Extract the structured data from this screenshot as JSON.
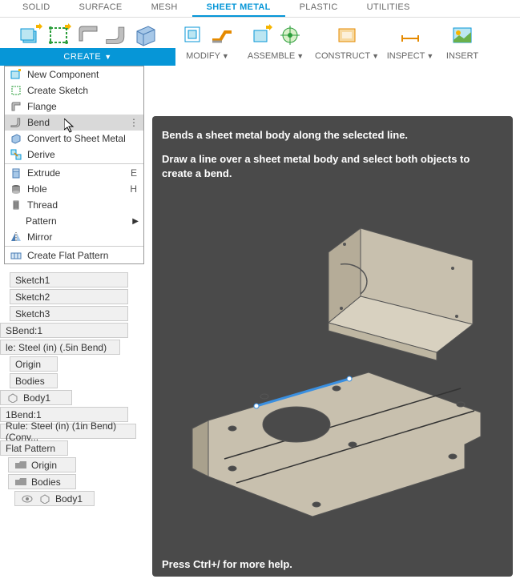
{
  "tabs": {
    "solid": "SOLID",
    "surface": "SURFACE",
    "mesh": "MESH",
    "sheetmetal": "SHEET METAL",
    "plastic": "PLASTIC",
    "utilities": "UTILITIES"
  },
  "toolbar_groups": {
    "create": "CREATE",
    "modify": "MODIFY",
    "assemble": "ASSEMBLE",
    "construct": "CONSTRUCT",
    "inspect": "INSPECT",
    "insert": "INSERT"
  },
  "dropdown": {
    "new_component": "New Component",
    "create_sketch": "Create Sketch",
    "flange": "Flange",
    "bend": "Bend",
    "convert": "Convert to Sheet Metal",
    "derive": "Derive",
    "extrude": "Extrude",
    "extrude_key": "E",
    "hole": "Hole",
    "hole_key": "H",
    "thread": "Thread",
    "pattern": "Pattern",
    "mirror": "Mirror",
    "flat_pattern": "Create Flat Pattern"
  },
  "browser": {
    "sketch1": "Sketch1",
    "sketch2": "Sketch2",
    "sketch3": "Sketch3",
    "bend1": "SBend:1",
    "rule1": "le: Steel (in) (.5in Bend)",
    "origin": "Origin",
    "bodies": "Bodies",
    "body1": "Body1",
    "onebend": "1Bend:1",
    "rule2": "Rule: Steel (in) (1in Bend) (Conv...",
    "flatpattern": "Flat Pattern",
    "origin2": "Origin",
    "bodies2": "Bodies",
    "body1b": "Body1"
  },
  "tooltip": {
    "title": "Bends a sheet metal body along the selected line.",
    "body": "Draw a line over a sheet metal body and select both objects to create a bend.",
    "footer": "Press Ctrl+/ for more help."
  }
}
